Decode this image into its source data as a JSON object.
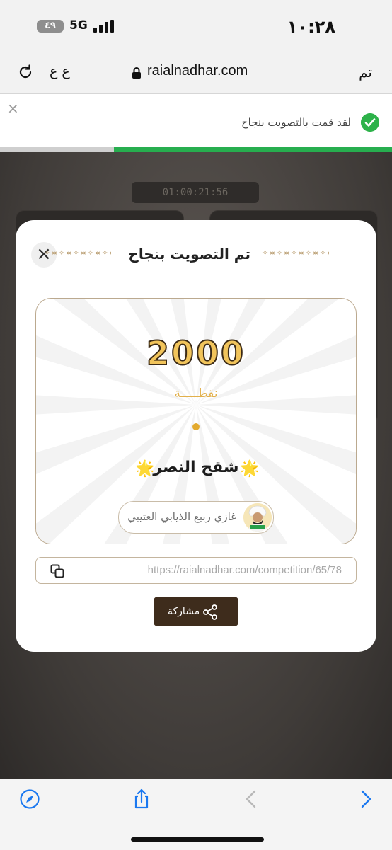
{
  "status_bar": {
    "time": "١٠:٢٨",
    "battery": "٤٩",
    "network": "5G"
  },
  "browser": {
    "url": "raialnadhar.com",
    "text_size_label": "ع ع",
    "done_label": "تم"
  },
  "toast": {
    "message": "لقد قمت بالتصويت بنجاح",
    "close": "×",
    "progress_fraction": 0.71
  },
  "background": {
    "timer": "01:00:21:56"
  },
  "modal": {
    "title": "تم التصويت بنجاح",
    "close": "×",
    "ornament": "✧∗✧∗✧∗✧∗✧∗✧∗✧∗",
    "points": "2000",
    "points_label": "نقطـــــة",
    "competitor_name": "شقح النصر",
    "owner_name": "غازي ربيع الذيابي العتيبي",
    "share_link": "https://raialnadhar.com/competition/65/78",
    "share_label": "مشاركة",
    "star": "🌟"
  },
  "colors": {
    "accent_brown": "#3e2c1c",
    "gold": "#f1c45b",
    "success_green": "#27ae4f",
    "ios_blue": "#1a78f0"
  },
  "icons": {
    "reload": "reload-icon",
    "lock": "lock-icon",
    "check": "check-circle-icon",
    "close": "close-icon",
    "copy": "copy-icon",
    "share": "share-icon",
    "compass": "compass-icon",
    "share_sheet": "share-sheet-icon",
    "back": "chevron-left-icon",
    "forward": "chevron-right-icon"
  }
}
